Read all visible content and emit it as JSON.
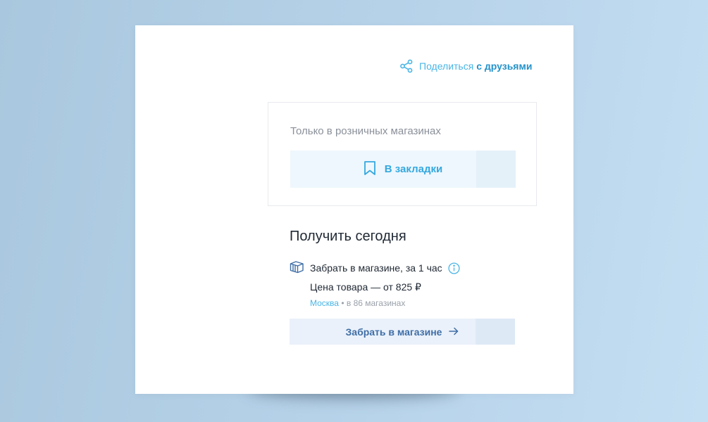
{
  "share": {
    "label_main": "Поделиться",
    "label_accent": "с друзьями",
    "icon": "share-icon"
  },
  "retail": {
    "title": "Только в розничных магазинах",
    "bookmark_label": "В закладки",
    "bookmark_icon": "bookmark-icon"
  },
  "today": {
    "title": "Получить сегодня",
    "pickup_text": "Забрать в магазине, за 1 час",
    "pickup_icon": "box-icon",
    "info_icon": "info-icon",
    "price_text": "Цена товара — от 825 ₽",
    "city": "Москва",
    "separator": "•",
    "stores_count": "в 86 магазинах",
    "button_label": "Забрать в магазине",
    "button_icon": "arrow-right-icon"
  },
  "colors": {
    "accent": "#49b5e6",
    "accent_dark": "#2592c9",
    "button_blue": "#3f6ea6",
    "text": "#1f2833",
    "muted": "#8a9099"
  }
}
